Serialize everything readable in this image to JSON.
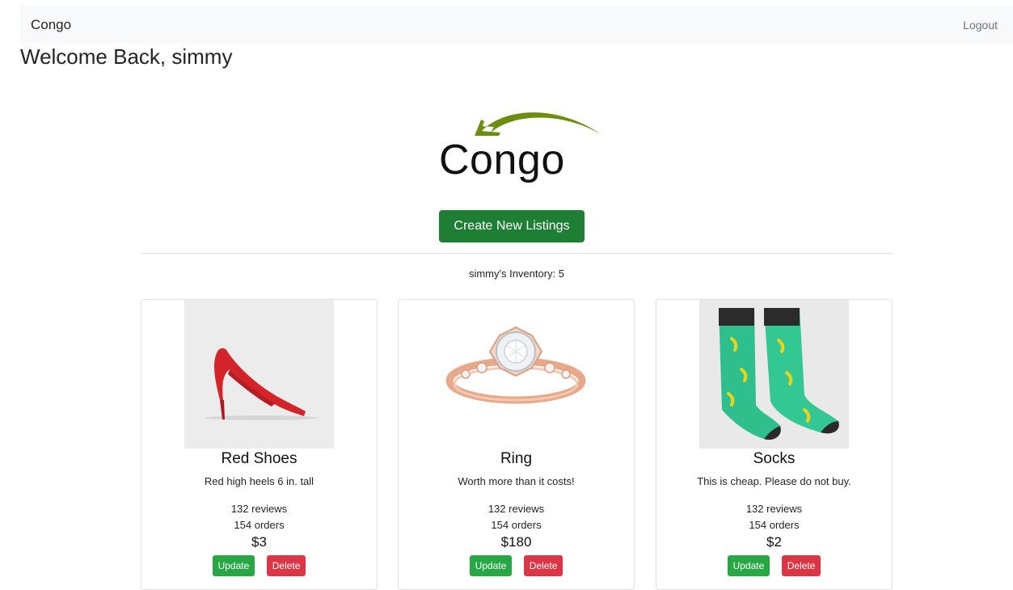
{
  "nav": {
    "brand": "Congo",
    "logout": "Logout"
  },
  "welcome": "Welcome Back, simmy",
  "logo": {
    "text": "Congo",
    "swoosh_color": "#6b8e0f"
  },
  "create_button": "Create New Listings",
  "inventory_label": "simmy's Inventory: 5",
  "colors": {
    "primary_green": "#1e7e34",
    "update_green": "#28a745",
    "delete_red": "#dc3545"
  },
  "products": [
    {
      "image_icon": "red-high-heel-shoe",
      "title": "Red Shoes",
      "description": "Red high heels 6 in. tall",
      "reviews": "132 reviews",
      "orders": "154 orders",
      "price": "$3",
      "update": "Update",
      "delete": "Delete"
    },
    {
      "image_icon": "diamond-ring",
      "title": "Ring",
      "description": "Worth more than it costs!",
      "reviews": "132 reviews",
      "orders": "154 orders",
      "price": "$180",
      "update": "Update",
      "delete": "Delete"
    },
    {
      "image_icon": "green-socks",
      "title": "Socks",
      "description": "This is cheap. Please do not buy.",
      "reviews": "132 reviews",
      "orders": "154 orders",
      "price": "$2",
      "update": "Update",
      "delete": "Delete"
    }
  ]
}
